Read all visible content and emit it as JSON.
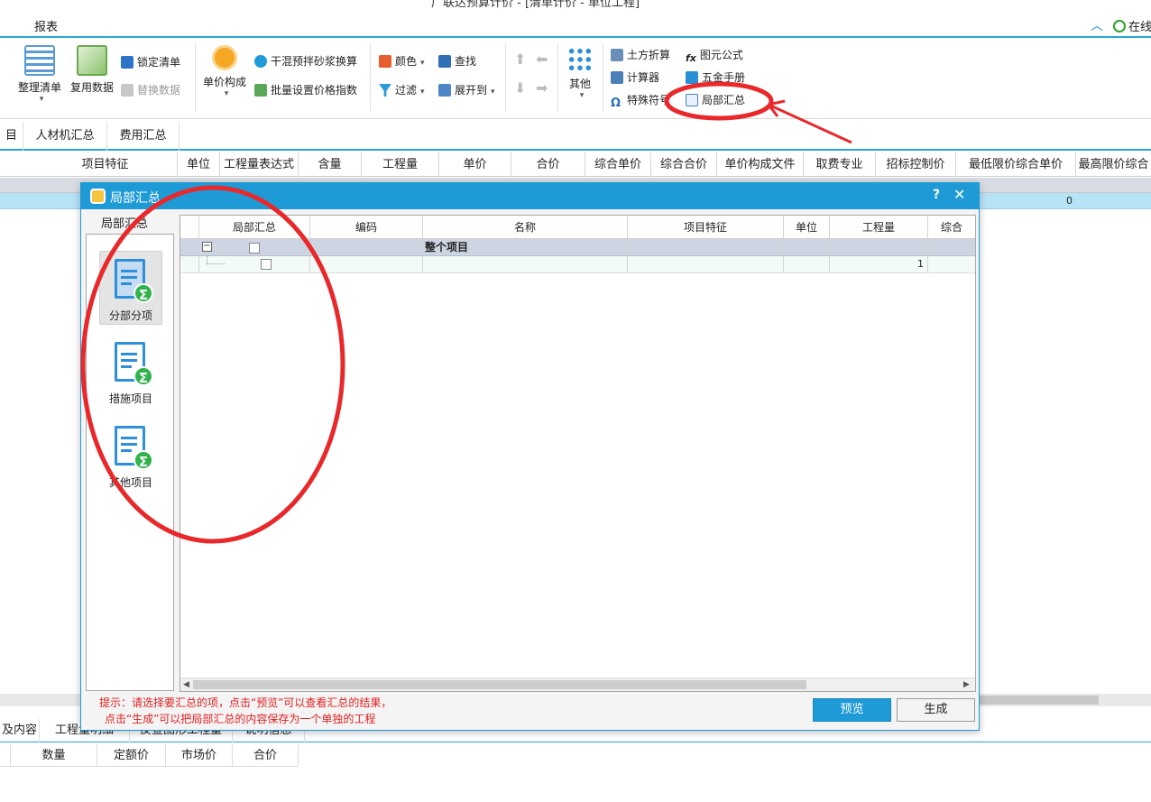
{
  "window": {
    "title_partial": "广联达预算计价 - [清单计价 - 单位工程]"
  },
  "menubar": {
    "report": "报表",
    "online": "在线"
  },
  "ribbon": {
    "sort_list": "整理清单",
    "reuse_data": "复用数据",
    "lock_list": "锁定清单",
    "replace_data": "替换数据",
    "unit_price_composition": "单价构成",
    "dry_mortar": "干混预拌砂浆换算",
    "batch_price_index": "批量设置价格指数",
    "color": "颜色",
    "find": "查找",
    "filter": "过滤",
    "expand_to": "展开到",
    "other": "其他",
    "earthwork": "土方折算",
    "element_formula": "图元公式",
    "calculator": "计算器",
    "hardware_manual": "五金手册",
    "special_symbol": "特殊符号",
    "partial_summary": "局部汇总"
  },
  "tabs": [
    "目",
    "人材机汇总",
    "费用汇总"
  ],
  "grid": {
    "headers": [
      "项目特征",
      "单位",
      "工程量表达式",
      "含量",
      "工程量",
      "单价",
      "合价",
      "综合单价",
      "综合合价",
      "单价构成文件",
      "取费专业",
      "招标控制价",
      "最低限价综合单价",
      "最高限价综合"
    ],
    "blue_row_value": "0"
  },
  "bottom": {
    "tabs": [
      "及内容",
      "工程量明细",
      "反查图形工程量",
      "说明信息"
    ],
    "headers": [
      "数量",
      "定额价",
      "市场价",
      "合价"
    ]
  },
  "dialog": {
    "title": "局部汇总",
    "side_label": "局部汇总",
    "side_items": [
      "分部分项",
      "措施项目",
      "其他项目"
    ],
    "columns": [
      "局部汇总",
      "编码",
      "名称",
      "项目特征",
      "单位",
      "工程量",
      "综合"
    ],
    "rows": [
      {
        "name": "整个项目",
        "quantity": ""
      },
      {
        "name": "",
        "quantity": "1"
      }
    ],
    "hint_line1": "提示：请选择要汇总的项，点击“预览”可以查看汇总的结果，",
    "hint_line2": "点击“生成”可以把局部汇总的内容保存为一个单独的工程",
    "preview": "预览",
    "generate": "生成"
  },
  "colors": {
    "accent": "#1e9ad6",
    "annotation": "#e8282b"
  }
}
